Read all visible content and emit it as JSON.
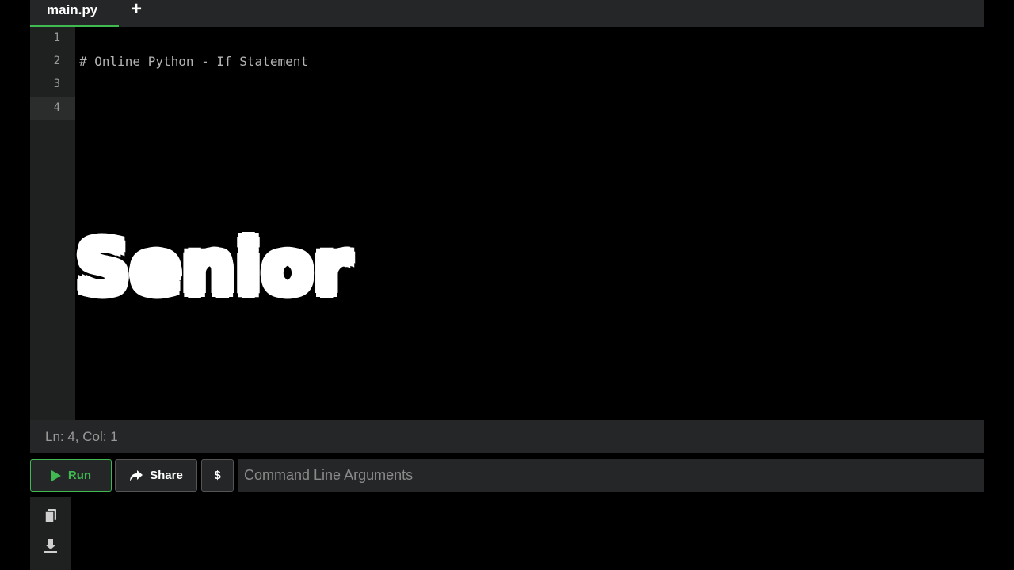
{
  "tabs": {
    "active_file": "main.py",
    "add_label": "+"
  },
  "editor": {
    "line_numbers": [
      "1",
      "2",
      "3",
      "4"
    ],
    "lines": [
      "",
      "# Online Python - If Statement",
      "",
      ""
    ],
    "active_line": 4
  },
  "status": {
    "position": "Ln: 4,  Col: 1"
  },
  "actions": {
    "run_label": "Run",
    "share_label": "Share",
    "args_label": "$",
    "args_placeholder": "Command Line Arguments"
  },
  "output": {
    "icons": [
      "copy-icon",
      "download-icon"
    ]
  },
  "overlay": {
    "caption": "Senior"
  },
  "colors": {
    "accent": "#3fb950",
    "panel": "#252627",
    "background": "#000000"
  }
}
